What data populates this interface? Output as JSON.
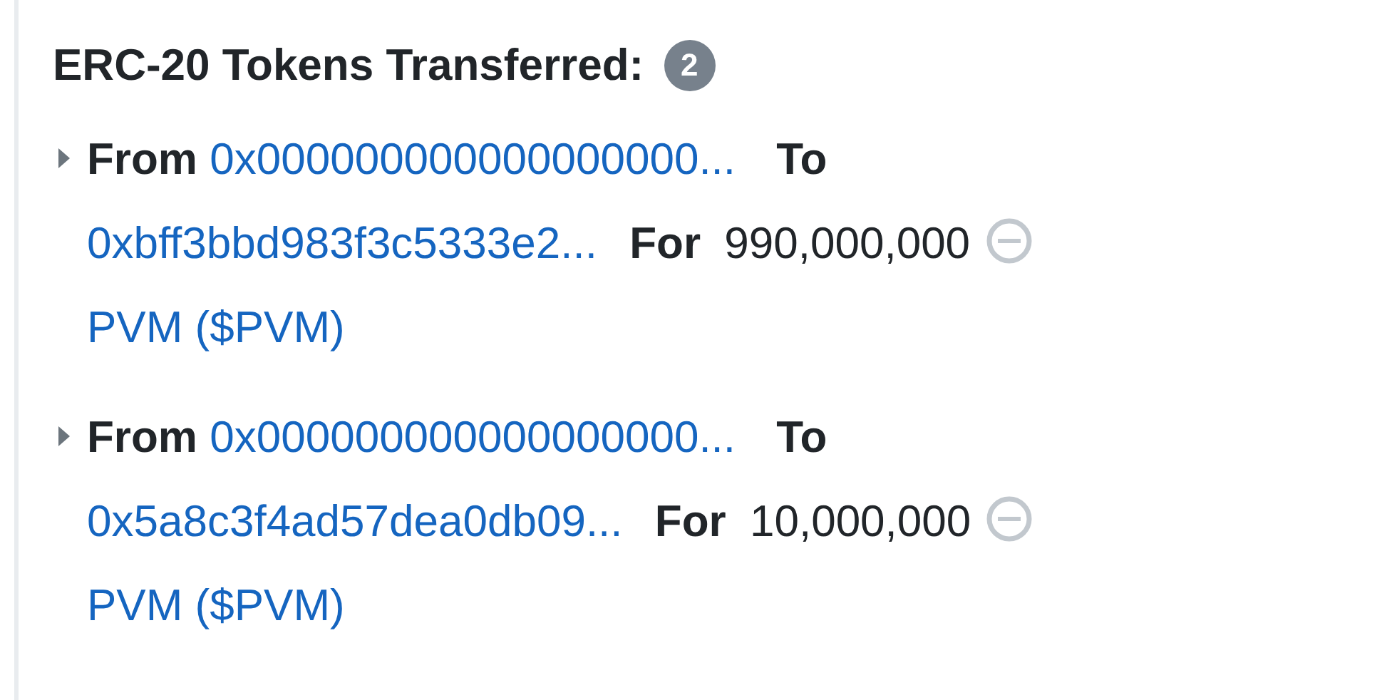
{
  "title": "ERC-20 Tokens Transferred:",
  "count": "2",
  "transfers": [
    {
      "from_label": "From",
      "from": "0x000000000000000000...",
      "to_label": "To",
      "to": "0xbff3bbd983f3c5333e2...",
      "for_label": "For",
      "amount": "990,000,000",
      "token": "PVM ($PVM)",
      "expanded": false
    },
    {
      "from_label": "From",
      "from": "0x000000000000000000...",
      "to_label": "To",
      "to": "0x5a8c3f4ad57dea0db09...",
      "for_label": "For",
      "amount": "10,000,000",
      "token": "PVM ($PVM)",
      "expanded": false
    }
  ]
}
